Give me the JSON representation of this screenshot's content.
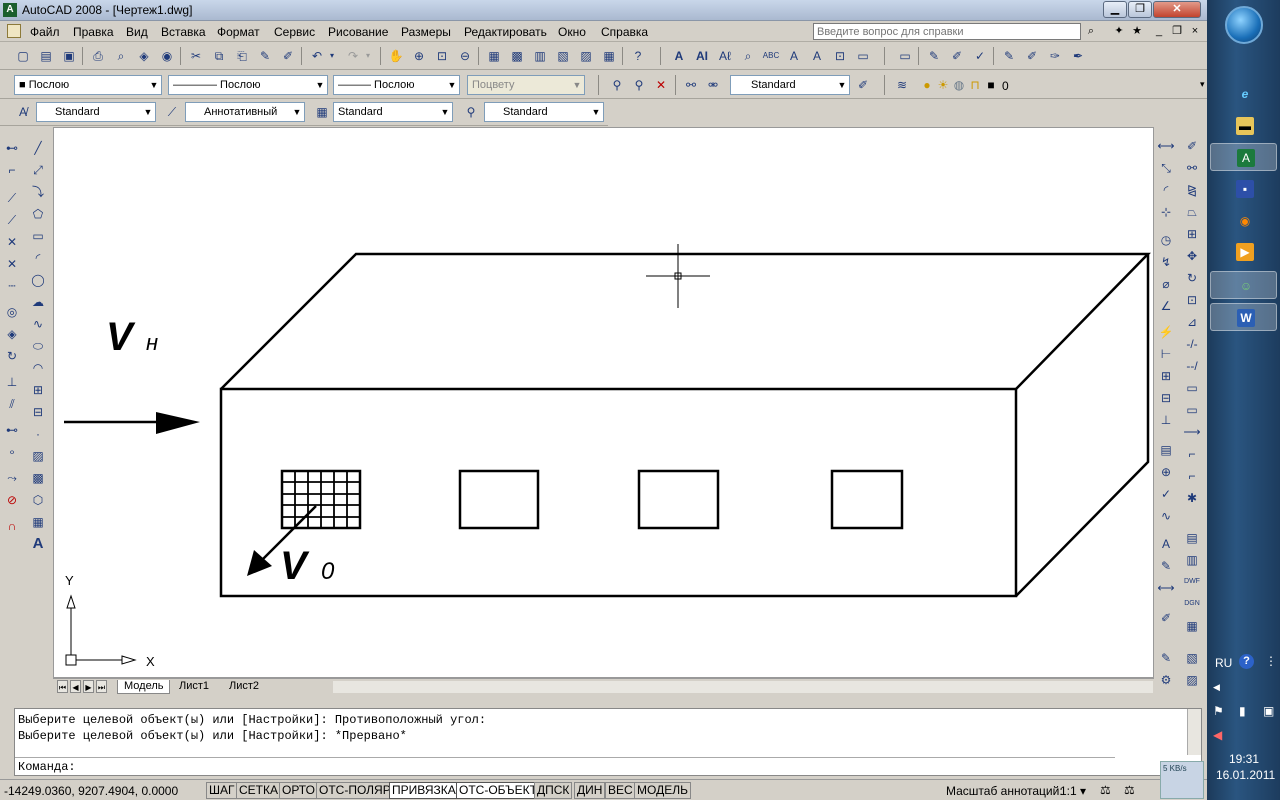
{
  "window": {
    "title": "AutoCAD 2008 - [Чертеж1.dwg]",
    "app_icon": "autocad-icon",
    "min": "▁",
    "max": "❐",
    "close": "✕"
  },
  "menu": {
    "items": [
      "Файл",
      "Правка",
      "Вид",
      "Вставка",
      "Формат",
      "Сервис",
      "Рисование",
      "Размеры",
      "Редактировать",
      "Окно",
      "Справка"
    ],
    "help_placeholder": "Введите вопрос для справки",
    "doc_min": "_",
    "doc_restore": "❐",
    "doc_close": "×"
  },
  "properties_toolbar": {
    "color": "■ Послою",
    "linetype": "———— Послою",
    "lineweight": "——— Послою",
    "plotstyle": "Поцвету",
    "table_style": "Standard",
    "layer": "0"
  },
  "styles_toolbar": {
    "text_style": "Standard",
    "annotative": "Аннотативный",
    "dim_style": "Standard",
    "multileader_style": "Standard"
  },
  "drawing": {
    "label_vn_main": "V",
    "label_vn_sub": "н",
    "label_v0_main": "V",
    "label_v0_sub": "0",
    "ucs_x": "X",
    "ucs_y": "Y"
  },
  "layout_tabs": [
    "Модель",
    "Лист1",
    "Лист2"
  ],
  "command": {
    "history": [
      "Выберите целевой объект(ы) или [Настройки]: Противоположный угол:",
      "Выберите целевой объект(ы) или [Настройки]: *Прервано*"
    ],
    "prompt": "Команда:",
    "value": ""
  },
  "status": {
    "coords": "-14249.0360, 9207.4904, 0.0000",
    "buttons": [
      {
        "label": "ШАГ",
        "on": false
      },
      {
        "label": "СЕТКА",
        "on": false
      },
      {
        "label": "ОРТО",
        "on": false
      },
      {
        "label": "ОТС-ПОЛЯР",
        "on": false
      },
      {
        "label": "ПРИВЯЗКА",
        "on": true
      },
      {
        "label": "ОТС-ОБЪЕКТ",
        "on": true
      },
      {
        "label": "ДПСК",
        "on": false
      },
      {
        "label": "ДИН",
        "on": false
      },
      {
        "label": "ВЕС",
        "on": false
      },
      {
        "label": "МОДЕЛЬ",
        "on": false
      }
    ],
    "annotation_scale_label": "Масштаб аннотаций:",
    "annotation_scale": "1:1 ▾"
  },
  "taskbar": {
    "language": "RU",
    "time": "19:31",
    "date": "16.01.2011",
    "net_speed": "5 KB/s"
  },
  "colors": {
    "canvas": "#ffffff",
    "drawing_lines": "#000000",
    "taskbar": "#2a5580"
  }
}
